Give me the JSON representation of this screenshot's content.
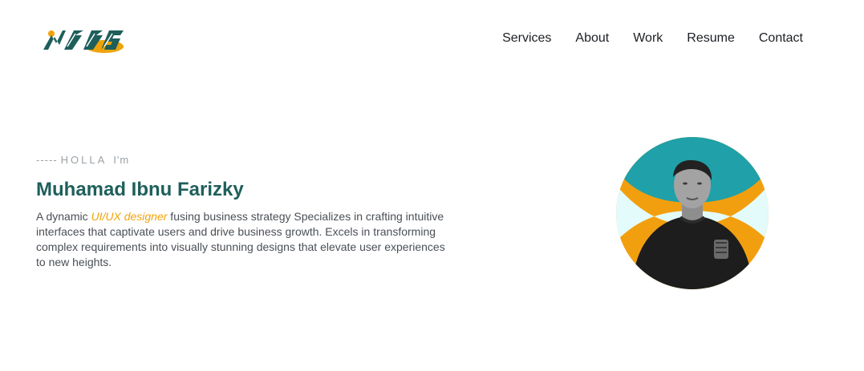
{
  "header": {
    "nav": [
      "Services",
      "About",
      "Work",
      "Resume",
      "Contact"
    ]
  },
  "hero": {
    "eyebrow_dashes": "-----",
    "eyebrow_greeting": "HOLLA",
    "eyebrow_suffix": "I'm",
    "name": "Muhamad Ibnu Farizky",
    "desc_prefix": "A dynamic ",
    "desc_highlight": "UI/UX designer",
    "desc_rest": " fusing business strategy Specializes in crafting intuitive interfaces that captivate users and drive business growth. Excels in transforming complex requirements into visually stunning designs that elevate user experiences to new heights."
  },
  "colors": {
    "brand_teal": "#1e5f5b",
    "accent_orange": "#f0a30a",
    "avatar_teal": "#20a0a8",
    "avatar_mint": "#e3fbfb",
    "avatar_orange": "#f29f0f"
  },
  "icons": {
    "logo": "nms-logo-mark",
    "portrait": "profile-portrait"
  }
}
